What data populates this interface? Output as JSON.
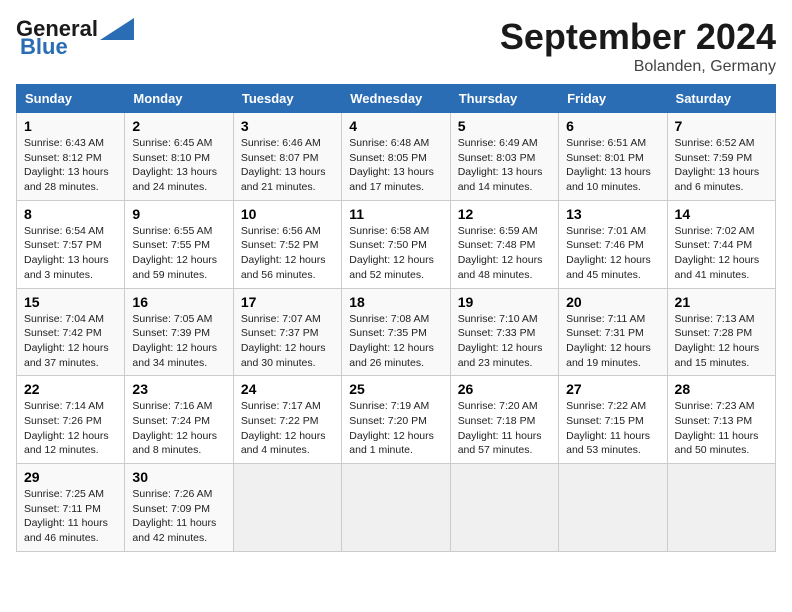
{
  "header": {
    "logo_general": "General",
    "logo_blue": "Blue",
    "month": "September 2024",
    "location": "Bolanden, Germany"
  },
  "weekdays": [
    "Sunday",
    "Monday",
    "Tuesday",
    "Wednesday",
    "Thursday",
    "Friday",
    "Saturday"
  ],
  "weeks": [
    [
      {
        "day": "1",
        "info": "Sunrise: 6:43 AM\nSunset: 8:12 PM\nDaylight: 13 hours\nand 28 minutes."
      },
      {
        "day": "2",
        "info": "Sunrise: 6:45 AM\nSunset: 8:10 PM\nDaylight: 13 hours\nand 24 minutes."
      },
      {
        "day": "3",
        "info": "Sunrise: 6:46 AM\nSunset: 8:07 PM\nDaylight: 13 hours\nand 21 minutes."
      },
      {
        "day": "4",
        "info": "Sunrise: 6:48 AM\nSunset: 8:05 PM\nDaylight: 13 hours\nand 17 minutes."
      },
      {
        "day": "5",
        "info": "Sunrise: 6:49 AM\nSunset: 8:03 PM\nDaylight: 13 hours\nand 14 minutes."
      },
      {
        "day": "6",
        "info": "Sunrise: 6:51 AM\nSunset: 8:01 PM\nDaylight: 13 hours\nand 10 minutes."
      },
      {
        "day": "7",
        "info": "Sunrise: 6:52 AM\nSunset: 7:59 PM\nDaylight: 13 hours\nand 6 minutes."
      }
    ],
    [
      {
        "day": "8",
        "info": "Sunrise: 6:54 AM\nSunset: 7:57 PM\nDaylight: 13 hours\nand 3 minutes."
      },
      {
        "day": "9",
        "info": "Sunrise: 6:55 AM\nSunset: 7:55 PM\nDaylight: 12 hours\nand 59 minutes."
      },
      {
        "day": "10",
        "info": "Sunrise: 6:56 AM\nSunset: 7:52 PM\nDaylight: 12 hours\nand 56 minutes."
      },
      {
        "day": "11",
        "info": "Sunrise: 6:58 AM\nSunset: 7:50 PM\nDaylight: 12 hours\nand 52 minutes."
      },
      {
        "day": "12",
        "info": "Sunrise: 6:59 AM\nSunset: 7:48 PM\nDaylight: 12 hours\nand 48 minutes."
      },
      {
        "day": "13",
        "info": "Sunrise: 7:01 AM\nSunset: 7:46 PM\nDaylight: 12 hours\nand 45 minutes."
      },
      {
        "day": "14",
        "info": "Sunrise: 7:02 AM\nSunset: 7:44 PM\nDaylight: 12 hours\nand 41 minutes."
      }
    ],
    [
      {
        "day": "15",
        "info": "Sunrise: 7:04 AM\nSunset: 7:42 PM\nDaylight: 12 hours\nand 37 minutes."
      },
      {
        "day": "16",
        "info": "Sunrise: 7:05 AM\nSunset: 7:39 PM\nDaylight: 12 hours\nand 34 minutes."
      },
      {
        "day": "17",
        "info": "Sunrise: 7:07 AM\nSunset: 7:37 PM\nDaylight: 12 hours\nand 30 minutes."
      },
      {
        "day": "18",
        "info": "Sunrise: 7:08 AM\nSunset: 7:35 PM\nDaylight: 12 hours\nand 26 minutes."
      },
      {
        "day": "19",
        "info": "Sunrise: 7:10 AM\nSunset: 7:33 PM\nDaylight: 12 hours\nand 23 minutes."
      },
      {
        "day": "20",
        "info": "Sunrise: 7:11 AM\nSunset: 7:31 PM\nDaylight: 12 hours\nand 19 minutes."
      },
      {
        "day": "21",
        "info": "Sunrise: 7:13 AM\nSunset: 7:28 PM\nDaylight: 12 hours\nand 15 minutes."
      }
    ],
    [
      {
        "day": "22",
        "info": "Sunrise: 7:14 AM\nSunset: 7:26 PM\nDaylight: 12 hours\nand 12 minutes."
      },
      {
        "day": "23",
        "info": "Sunrise: 7:16 AM\nSunset: 7:24 PM\nDaylight: 12 hours\nand 8 minutes."
      },
      {
        "day": "24",
        "info": "Sunrise: 7:17 AM\nSunset: 7:22 PM\nDaylight: 12 hours\nand 4 minutes."
      },
      {
        "day": "25",
        "info": "Sunrise: 7:19 AM\nSunset: 7:20 PM\nDaylight: 12 hours\nand 1 minute."
      },
      {
        "day": "26",
        "info": "Sunrise: 7:20 AM\nSunset: 7:18 PM\nDaylight: 11 hours\nand 57 minutes."
      },
      {
        "day": "27",
        "info": "Sunrise: 7:22 AM\nSunset: 7:15 PM\nDaylight: 11 hours\nand 53 minutes."
      },
      {
        "day": "28",
        "info": "Sunrise: 7:23 AM\nSunset: 7:13 PM\nDaylight: 11 hours\nand 50 minutes."
      }
    ],
    [
      {
        "day": "29",
        "info": "Sunrise: 7:25 AM\nSunset: 7:11 PM\nDaylight: 11 hours\nand 46 minutes."
      },
      {
        "day": "30",
        "info": "Sunrise: 7:26 AM\nSunset: 7:09 PM\nDaylight: 11 hours\nand 42 minutes."
      },
      {
        "day": "",
        "info": ""
      },
      {
        "day": "",
        "info": ""
      },
      {
        "day": "",
        "info": ""
      },
      {
        "day": "",
        "info": ""
      },
      {
        "day": "",
        "info": ""
      }
    ]
  ]
}
